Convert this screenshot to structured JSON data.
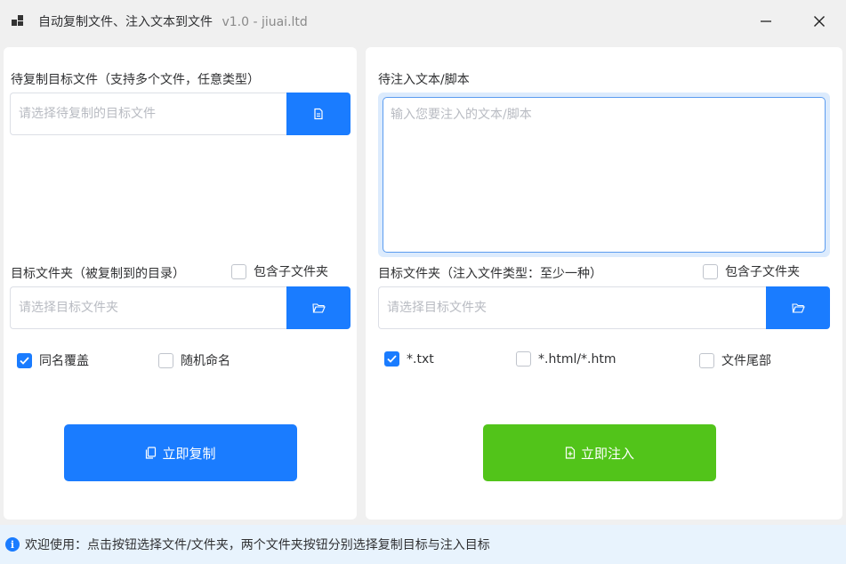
{
  "window": {
    "title": "自动复制文件、注入文本到文件",
    "version": "v1.0 - jiuai.ltd",
    "controls": [
      "minimize-icon",
      "close-icon"
    ]
  },
  "copy_panel": {
    "target_files_label": "待复制目标文件（支持多个文件，任意类型）",
    "target_files_placeholder": "请选择待复制的目标文件",
    "target_files_button_icon": "file-icon",
    "dest_folder_label": "目标文件夹（被复制到的目录）",
    "include_subfolders_label": "包含子文件夹",
    "include_subfolders_checked": false,
    "dest_folder_placeholder": "请选择目标文件夹",
    "dest_folder_button_icon": "folder-icon",
    "overwrite_label": "同名覆盖",
    "overwrite_checked": true,
    "random_name_label": "随机命名",
    "random_name_checked": false,
    "copy_button_label": "立即复制",
    "copy_button_icon": "copy-icon"
  },
  "inject_panel": {
    "text_label": "待注入文本/脚本",
    "text_placeholder": "输入您要注入的文本/脚本",
    "dest_folder_label": "目标文件夹（注入文件类型：至少一种）",
    "include_subfolders_label": "包含子文件夹",
    "include_subfolders_checked": false,
    "dest_folder_placeholder": "请选择目标文件夹",
    "dest_folder_button_icon": "folder-icon",
    "types": [
      {
        "label": "*.txt",
        "checked": true
      },
      {
        "label": "*.html/*.htm",
        "checked": false
      },
      {
        "label": "文件尾部",
        "checked": false
      }
    ],
    "inject_button_label": "立即注入",
    "inject_button_icon": "file-add-icon"
  },
  "status": {
    "icon": "info-icon",
    "text": "欢迎使用：点击按钮选择文件/文件夹，两个文件夹按钮分别选择复制目标与注入目标"
  },
  "colors": {
    "primary": "#1a7cff",
    "success": "#52c41a",
    "status_bg": "#e8f3fd"
  }
}
